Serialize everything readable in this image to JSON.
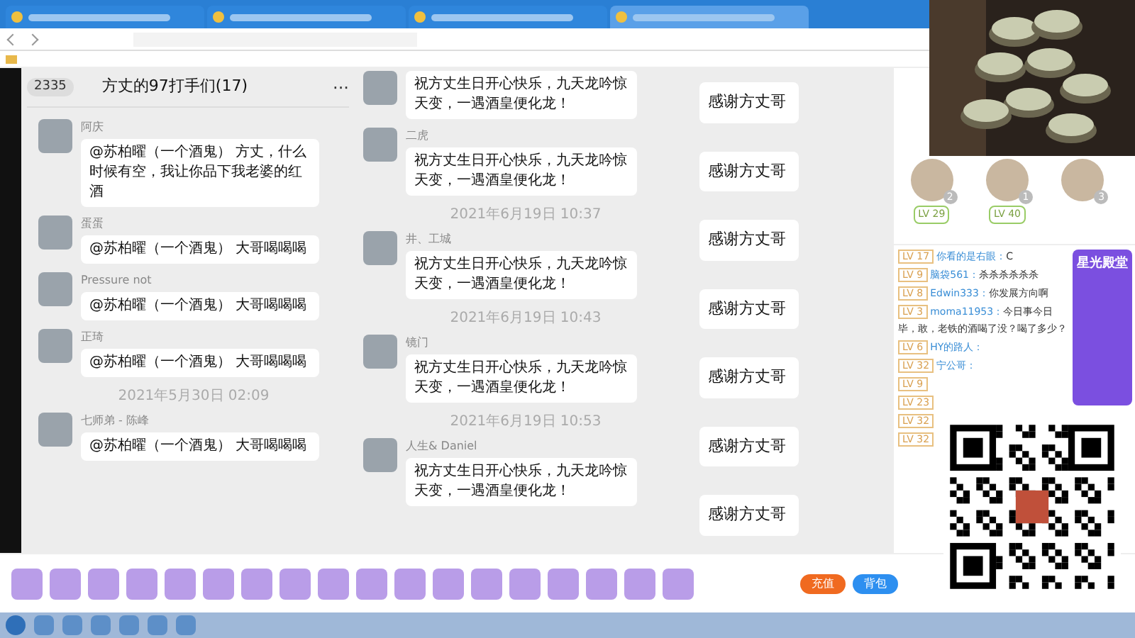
{
  "browser": {
    "tabs": [
      {
        "selected": false
      },
      {
        "selected": false
      },
      {
        "selected": false
      },
      {
        "selected": true
      }
    ]
  },
  "chat": {
    "back_count": "2335",
    "title": "方丈的97打手们(17)",
    "more": "···",
    "left_messages": [
      {
        "kind": "message",
        "sender": "阿庆",
        "text": "@苏柏曜（一个酒鬼） 方丈，什么时候有空，我让你品下我老婆的红酒"
      },
      {
        "kind": "message",
        "sender": "蛋蛋",
        "text": "@苏柏曜（一个酒鬼） 大哥喝喝喝"
      },
      {
        "kind": "message",
        "sender": "Pressure not",
        "text": "@苏柏曜（一个酒鬼） 大哥喝喝喝"
      },
      {
        "kind": "message",
        "sender": "正琦",
        "text": "@苏柏曜（一个酒鬼） 大哥喝喝喝"
      },
      {
        "kind": "time",
        "text": "2021年5月30日 02:09"
      },
      {
        "kind": "message",
        "sender": "七师弟 - 陈峰",
        "text": "@苏柏曜（一个酒鬼） 大哥喝喝喝"
      }
    ],
    "right_messages": [
      {
        "kind": "message",
        "text": "祝方丈生日开心快乐，九天龙吟惊天变，一遇酒皇便化龙！"
      },
      {
        "kind": "message",
        "sender": "二虎",
        "text": "祝方丈生日开心快乐，九天龙吟惊天变，一遇酒皇便化龙！"
      },
      {
        "kind": "time",
        "text": "2021年6月19日 10:37"
      },
      {
        "kind": "message",
        "sender": "井、工城",
        "text": "祝方丈生日开心快乐，九天龙吟惊天变，一遇酒皇便化龙！"
      },
      {
        "kind": "time",
        "text": "2021年6月19日 10:43"
      },
      {
        "kind": "message",
        "sender": "镜门",
        "text": "祝方丈生日开心快乐，九天龙吟惊天变，一遇酒皇便化龙！"
      },
      {
        "kind": "time",
        "text": "2021年6月19日 10:53"
      },
      {
        "kind": "message",
        "sender": "人生& Daniel",
        "text": "祝方丈生日开心快乐，九天龙吟惊天变，一遇酒皇便化龙！"
      }
    ],
    "thanks": [
      "感谢方丈哥",
      "感谢方丈哥",
      "感谢方丈哥",
      "感谢方丈哥",
      "感谢方丈哥",
      "感谢方丈哥",
      "感谢方丈哥"
    ]
  },
  "ranking": [
    {
      "rank": "2",
      "level": "LV 29"
    },
    {
      "rank": "1",
      "level": "LV 40"
    },
    {
      "rank": "3"
    }
  ],
  "promo": {
    "title": "星光殿堂"
  },
  "room_chat": [
    {
      "level": "LV 17",
      "user": "你看的是右眼：",
      "text": "C"
    },
    {
      "level": "LV 9",
      "user": "脑袋561：",
      "text": "杀杀杀杀杀杀"
    },
    {
      "level": "LV 8",
      "user": "Edwin333：",
      "text": "你发展方向啊"
    },
    {
      "level": "LV 3",
      "user": "moma11953：",
      "text": "今日事今日毕，敢，老铁的酒喝了没？喝了多少？"
    },
    {
      "level": "LV 6",
      "user": "HY的路人："
    },
    {
      "level": "LV 32",
      "user": "宁公哥："
    },
    {
      "level": "LV 9"
    },
    {
      "level": "LV 23"
    },
    {
      "level": "LV 32"
    },
    {
      "level": "LV 32"
    }
  ],
  "bottom_bar": {
    "recharge": "充值",
    "backpack": "背包"
  }
}
